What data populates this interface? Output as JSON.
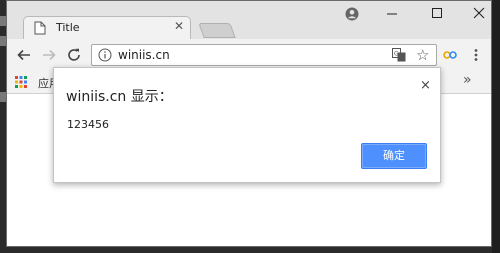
{
  "tab": {
    "title": "Title"
  },
  "address_bar": {
    "url": "winiis.cn"
  },
  "bookmarks": {
    "apps_label": "应用",
    "overflow_label": "»"
  },
  "dialog": {
    "title": "winiis.cn 显示：",
    "message": "123456",
    "ok_label": "确定",
    "close_glyph": "×"
  },
  "colors": {
    "accent": "#4d90fe",
    "chrome": "#f2f2f2",
    "titlebar": "#e3e3e3"
  }
}
